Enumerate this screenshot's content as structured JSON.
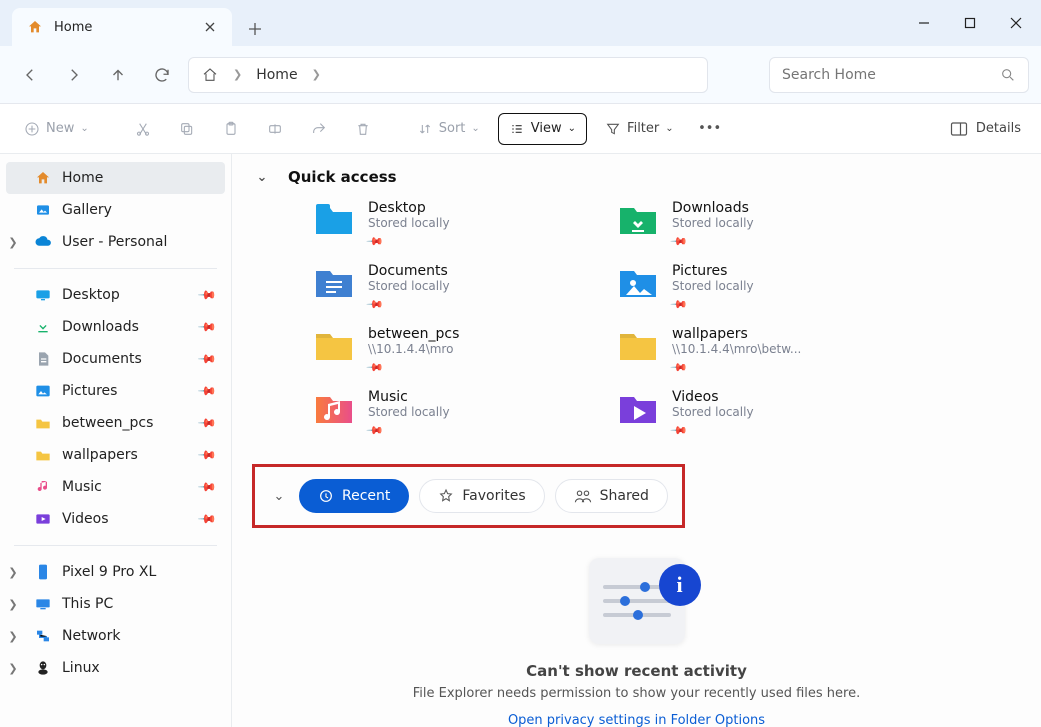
{
  "window": {
    "tab_title": "Home"
  },
  "address": {
    "crumb0": "Home"
  },
  "search": {
    "placeholder": "Search Home"
  },
  "toolbar": {
    "new_label": "New",
    "sort_label": "Sort",
    "view_label": "View",
    "filter_label": "Filter",
    "details_label": "Details"
  },
  "sidebar": {
    "home": "Home",
    "gallery": "Gallery",
    "user": "User - Personal",
    "pinned": [
      {
        "label": "Desktop"
      },
      {
        "label": "Downloads"
      },
      {
        "label": "Documents"
      },
      {
        "label": "Pictures"
      },
      {
        "label": "between_pcs"
      },
      {
        "label": "wallpapers"
      },
      {
        "label": "Music"
      },
      {
        "label": "Videos"
      }
    ],
    "devices": [
      {
        "label": "Pixel 9 Pro XL"
      },
      {
        "label": "This PC"
      },
      {
        "label": "Network"
      },
      {
        "label": "Linux"
      }
    ]
  },
  "quick_access": {
    "title": "Quick access",
    "items": [
      {
        "name": "Desktop",
        "sub": "Stored locally",
        "icon": "desktop",
        "color": "#1aa0e6"
      },
      {
        "name": "Downloads",
        "sub": "Stored locally",
        "icon": "downloads",
        "color": "#17b26b"
      },
      {
        "name": "Documents",
        "sub": "Stored locally",
        "icon": "documents",
        "color": "#3f80d1"
      },
      {
        "name": "Pictures",
        "sub": "Stored locally",
        "icon": "pictures",
        "color": "#1f8fe6"
      },
      {
        "name": "between_pcs",
        "sub": "\\\\10.1.4.4\\mro",
        "icon": "folder",
        "color": "#f5c542"
      },
      {
        "name": "wallpapers",
        "sub": "\\\\10.1.4.4\\mro\\betw...",
        "icon": "folder",
        "color": "#f5c542"
      },
      {
        "name": "Music",
        "sub": "Stored locally",
        "icon": "music",
        "color": "#f06b3b"
      },
      {
        "name": "Videos",
        "sub": "Stored locally",
        "icon": "videos",
        "color": "#7a3fdb"
      }
    ]
  },
  "pills": {
    "recent": "Recent",
    "favorites": "Favorites",
    "shared": "Shared"
  },
  "recent_empty": {
    "title": "Can't show recent activity",
    "body": "File Explorer needs permission to show your recently used files here.",
    "link": "Open privacy settings in Folder Options"
  }
}
